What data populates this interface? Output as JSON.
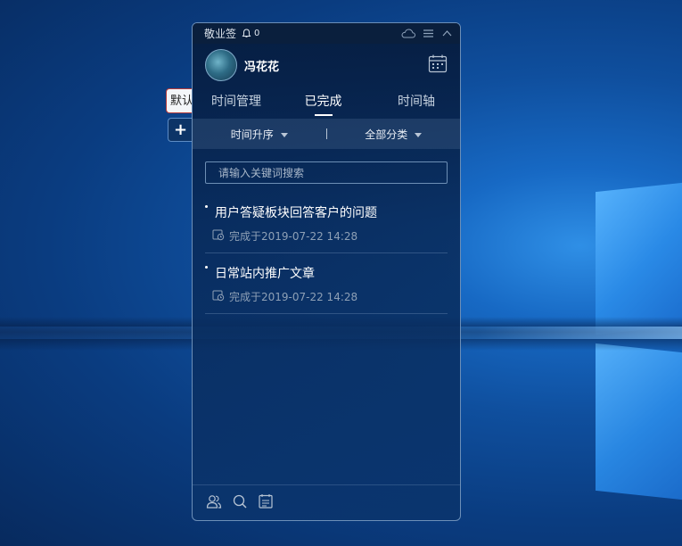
{
  "app": {
    "title": "敬业签",
    "notification_count": "0"
  },
  "side_tabs": {
    "default_label": "默认",
    "add_label": "+"
  },
  "profile": {
    "username": "冯花花"
  },
  "tabs": [
    {
      "label": "时间管理",
      "active": false
    },
    {
      "label": "已完成",
      "active": true
    },
    {
      "label": "时间轴",
      "active": false
    }
  ],
  "filters": {
    "sort_label": "时间升序",
    "category_label": "全部分类"
  },
  "search": {
    "placeholder": "请输入关键词搜索",
    "value": ""
  },
  "items": [
    {
      "title": "用户答疑板块回答客户的问题",
      "completed": "完成于2019-07-22 14:28"
    },
    {
      "title": "日常站内推广文章",
      "completed": "完成于2019-07-22 14:28"
    }
  ],
  "icons": [
    "bell-icon",
    "cloud-icon",
    "menu-icon",
    "collapse-icon",
    "calendar-icon",
    "clock-icon",
    "users-icon",
    "search-icon",
    "notes-icon"
  ],
  "colors": {
    "accent": "#ffffff",
    "window_bg": "#0a2a5a",
    "desktop_bg": "#1769c4"
  }
}
